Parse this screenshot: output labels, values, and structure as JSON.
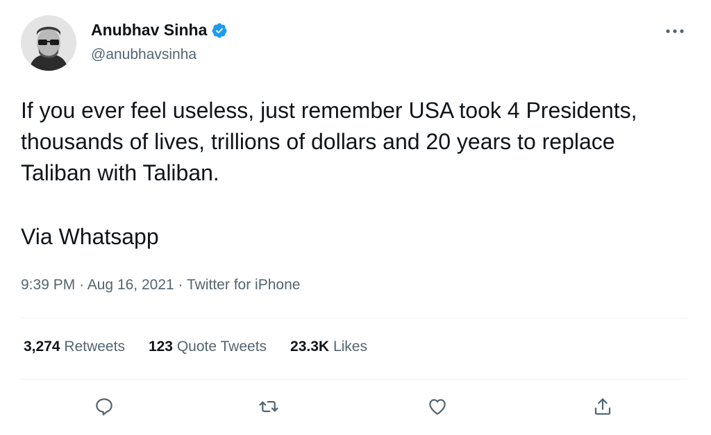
{
  "author": {
    "name": "Anubhav Sinha",
    "handle": "@anubhavsinha",
    "verified": true
  },
  "more_button": {
    "glyph": "•••"
  },
  "tweet": {
    "paragraph_1": "If you ever feel useless, just remember USA took 4 Presidents, thousands of lives, trillions of dollars and 20 years to replace Taliban with Taliban.",
    "paragraph_2": "Via Whatsapp"
  },
  "meta": {
    "time": "9:39 PM",
    "separator_1": "·",
    "date": "Aug 16, 2021",
    "separator_2": "·",
    "source": "Twitter for iPhone"
  },
  "stats": {
    "retweets": {
      "count": "3,274",
      "label": "Retweets"
    },
    "quote_tweets": {
      "count": "123",
      "label": "Quote Tweets"
    },
    "likes": {
      "count": "23.3K",
      "label": "Likes"
    }
  },
  "icons": {
    "reply": "reply-icon",
    "retweet": "retweet-icon",
    "like": "heart-icon",
    "share": "share-icon",
    "verified": "verified-badge-icon",
    "more": "more-horizontal-icon"
  },
  "colors": {
    "text_primary": "#0f1419",
    "text_secondary": "#536471",
    "verified_blue": "#1d9bf0",
    "divider": "#eff3f4"
  }
}
